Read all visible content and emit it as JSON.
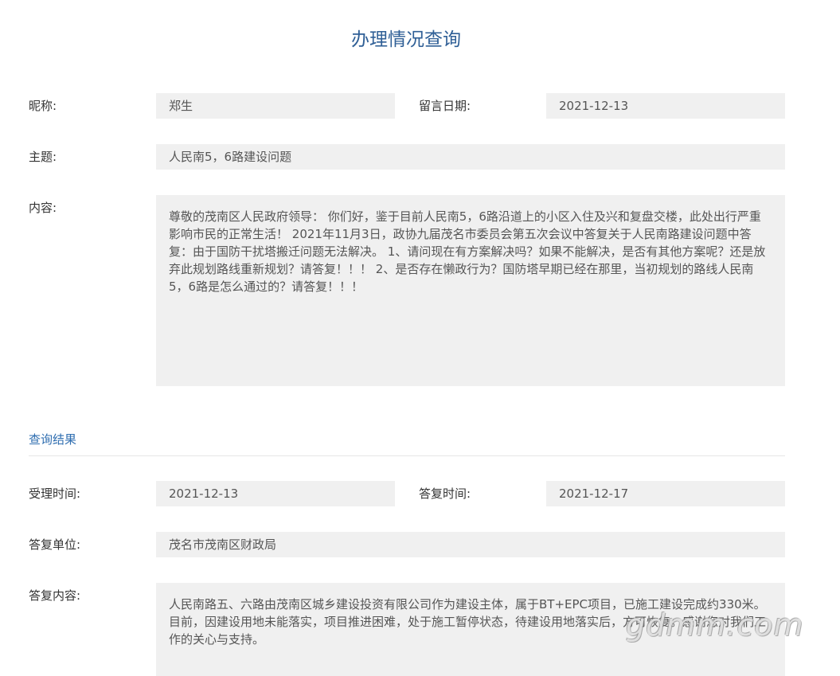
{
  "page": {
    "title": "办理情况查询"
  },
  "message": {
    "nickname_label": "昵称:",
    "nickname": "郑生",
    "date_label": "留言日期:",
    "date": "2021-12-13",
    "subject_label": "主题:",
    "subject": "人民南5，6路建设问题",
    "content_label": "内容:",
    "content": "尊敬的茂南区人民政府领导： 你们好，鉴于目前人民南5，6路沿道上的小区入住及兴和复盘交楼，此处出行严重影响市民的正常生活！ 2021年11月3日，政协九届茂名市委员会第五次会议中答复关于人民南路建设问题中答复：由于国防干扰塔搬迁问题无法解决。 1、请问现在有方案解决吗？如果不能解决，是否有其他方案呢？还是放弃此规划路线重新规划？请答复！！！ 2、是否存在懒政行为？国防塔早期已经在那里，当初规划的路线人民南5，6路是怎么通过的？请答复！！！"
  },
  "result": {
    "section_title": "查询结果",
    "accept_time_label": "受理时间:",
    "accept_time": "2021-12-13",
    "reply_time_label": "答复时间:",
    "reply_time": "2021-12-17",
    "reply_unit_label": "答复单位:",
    "reply_unit": "茂名市茂南区财政局",
    "reply_content_label": "答复内容:",
    "reply_content": "人民南路五、六路由茂南区城乡建设投资有限公司作为建设主体，属于BT+EPC项目，已施工建设完成约330米。目前，因建设用地未能落实，项目推进困难，处于施工暂停状态，待建设用地落实后，方可恢复。感谢您对我们工作的关心与支持。"
  },
  "watermark": {
    "text": "gdmm.com"
  }
}
